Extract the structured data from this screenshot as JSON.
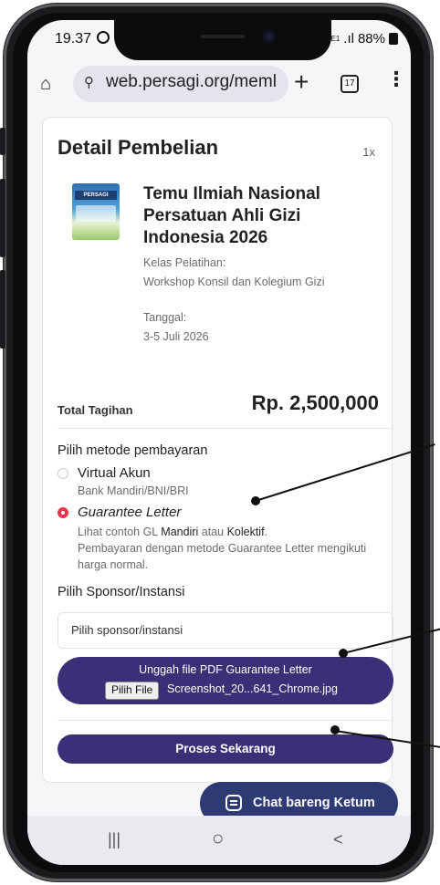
{
  "status_bar": {
    "time": "19.37",
    "network": "Vo)) LTE1",
    "signal": ".ıl",
    "battery": "88%"
  },
  "browser": {
    "url": "web.persagi.org/meml",
    "tab_count": "17",
    "plus": "+",
    "more": "⋮",
    "home": "⌂",
    "tune": "⚲"
  },
  "order": {
    "title": "Detail Pembelian",
    "quantity": "1x",
    "poster_text": "PERSAGI",
    "product_name": "Temu Ilmiah Nasional Persatuan Ahli Gizi Indonesia 2026",
    "class_label": "Kelas Pelatihan:",
    "class_value": "Workshop Konsil dan Kolegium Gizi",
    "date_label": "Tanggal:",
    "date_value": "3-5 Juli 2026",
    "total_label": "Total Tagihan",
    "total_value": "Rp. 2,500,000"
  },
  "payment": {
    "label": "Pilih metode pembayaran",
    "options": [
      {
        "name": "Virtual Akun",
        "sub": "Bank Mandiri/BNI/BRI",
        "selected": false
      },
      {
        "name": "Guarantee Letter",
        "selected": true,
        "desc_prefix": "Lihat contoh GL ",
        "desc_link1": "Mandiri",
        "desc_mid": " atau ",
        "desc_link2": "Kolektif",
        "desc_suffix": ".",
        "desc_note": "Pembayaran dengan metode Guarantee Letter mengikuti harga normal."
      }
    ]
  },
  "sponsor": {
    "label": "Pilih Sponsor/Instansi",
    "placeholder": "Pilih sponsor/instansi"
  },
  "upload": {
    "title": "Unggah file PDF Guarantee Letter",
    "button": "Pilih File",
    "filename": "Screenshot_20...641_Chrome.jpg"
  },
  "submit_label": "Proses Sekarang",
  "chat_label": "Chat bareng Ketum",
  "nav": {
    "recent": "|||",
    "home": "○",
    "back": "<"
  },
  "colors": {
    "primary": "#3b2f77",
    "chat": "#2d3a74",
    "radio_selected": "#e8344a"
  }
}
